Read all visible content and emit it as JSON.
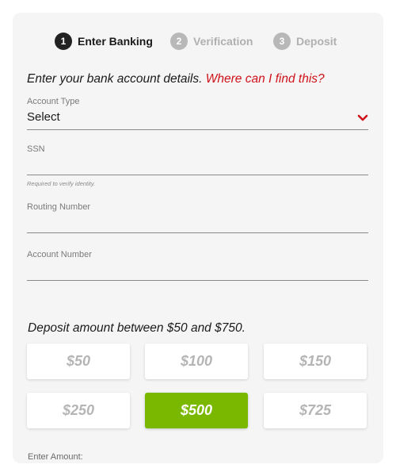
{
  "stepper": {
    "steps": [
      {
        "number": "1",
        "label": "Enter Banking",
        "state": "active"
      },
      {
        "number": "2",
        "label": "Verification",
        "state": "inactive"
      },
      {
        "number": "3",
        "label": "Deposit",
        "state": "inactive"
      }
    ]
  },
  "bank_details": {
    "heading": "Enter your bank account details.",
    "help_link": "Where can I find this?",
    "account_type": {
      "label": "Account Type",
      "value": "Select"
    },
    "ssn": {
      "label": "SSN",
      "value": "",
      "hint": "Required to verify identity."
    },
    "routing_number": {
      "label": "Routing Number",
      "value": ""
    },
    "account_number": {
      "label": "Account Number",
      "value": ""
    }
  },
  "deposit": {
    "heading": "Deposit amount between $50 and $750.",
    "amounts": [
      {
        "label": "$50",
        "selected": false
      },
      {
        "label": "$100",
        "selected": false
      },
      {
        "label": "$150",
        "selected": false
      },
      {
        "label": "$250",
        "selected": false
      },
      {
        "label": "$500",
        "selected": true
      },
      {
        "label": "$725",
        "selected": false
      }
    ],
    "enter_amount_label": "Enter Amount:"
  },
  "colors": {
    "accent_red": "#d0121b",
    "selected_green": "#7ab800",
    "active_step": "#222222",
    "inactive_step": "#b8b8b8"
  },
  "icons": {
    "account_type_dropdown": "chevron-down-icon"
  }
}
